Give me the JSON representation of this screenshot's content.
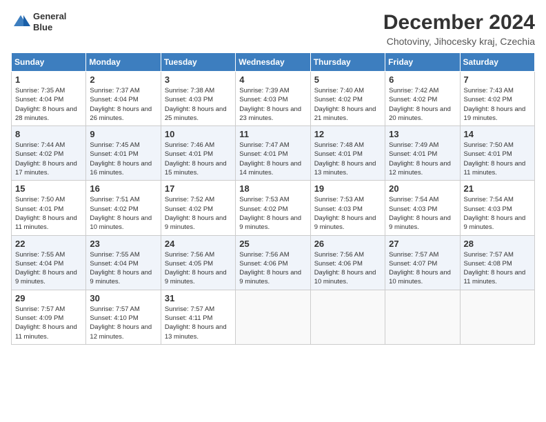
{
  "header": {
    "logo_line1": "General",
    "logo_line2": "Blue",
    "month_title": "December 2024",
    "location": "Chotoviny, Jihocesky kraj, Czechia"
  },
  "weekdays": [
    "Sunday",
    "Monday",
    "Tuesday",
    "Wednesday",
    "Thursday",
    "Friday",
    "Saturday"
  ],
  "weeks": [
    [
      {
        "day": "1",
        "sunrise": "7:35 AM",
        "sunset": "4:04 PM",
        "daylight": "8 hours and 28 minutes."
      },
      {
        "day": "2",
        "sunrise": "7:37 AM",
        "sunset": "4:04 PM",
        "daylight": "8 hours and 26 minutes."
      },
      {
        "day": "3",
        "sunrise": "7:38 AM",
        "sunset": "4:03 PM",
        "daylight": "8 hours and 25 minutes."
      },
      {
        "day": "4",
        "sunrise": "7:39 AM",
        "sunset": "4:03 PM",
        "daylight": "8 hours and 23 minutes."
      },
      {
        "day": "5",
        "sunrise": "7:40 AM",
        "sunset": "4:02 PM",
        "daylight": "8 hours and 21 minutes."
      },
      {
        "day": "6",
        "sunrise": "7:42 AM",
        "sunset": "4:02 PM",
        "daylight": "8 hours and 20 minutes."
      },
      {
        "day": "7",
        "sunrise": "7:43 AM",
        "sunset": "4:02 PM",
        "daylight": "8 hours and 19 minutes."
      }
    ],
    [
      {
        "day": "8",
        "sunrise": "7:44 AM",
        "sunset": "4:02 PM",
        "daylight": "8 hours and 17 minutes."
      },
      {
        "day": "9",
        "sunrise": "7:45 AM",
        "sunset": "4:01 PM",
        "daylight": "8 hours and 16 minutes."
      },
      {
        "day": "10",
        "sunrise": "7:46 AM",
        "sunset": "4:01 PM",
        "daylight": "8 hours and 15 minutes."
      },
      {
        "day": "11",
        "sunrise": "7:47 AM",
        "sunset": "4:01 PM",
        "daylight": "8 hours and 14 minutes."
      },
      {
        "day": "12",
        "sunrise": "7:48 AM",
        "sunset": "4:01 PM",
        "daylight": "8 hours and 13 minutes."
      },
      {
        "day": "13",
        "sunrise": "7:49 AM",
        "sunset": "4:01 PM",
        "daylight": "8 hours and 12 minutes."
      },
      {
        "day": "14",
        "sunrise": "7:50 AM",
        "sunset": "4:01 PM",
        "daylight": "8 hours and 11 minutes."
      }
    ],
    [
      {
        "day": "15",
        "sunrise": "7:50 AM",
        "sunset": "4:01 PM",
        "daylight": "8 hours and 11 minutes."
      },
      {
        "day": "16",
        "sunrise": "7:51 AM",
        "sunset": "4:02 PM",
        "daylight": "8 hours and 10 minutes."
      },
      {
        "day": "17",
        "sunrise": "7:52 AM",
        "sunset": "4:02 PM",
        "daylight": "8 hours and 9 minutes."
      },
      {
        "day": "18",
        "sunrise": "7:53 AM",
        "sunset": "4:02 PM",
        "daylight": "8 hours and 9 minutes."
      },
      {
        "day": "19",
        "sunrise": "7:53 AM",
        "sunset": "4:03 PM",
        "daylight": "8 hours and 9 minutes."
      },
      {
        "day": "20",
        "sunrise": "7:54 AM",
        "sunset": "4:03 PM",
        "daylight": "8 hours and 9 minutes."
      },
      {
        "day": "21",
        "sunrise": "7:54 AM",
        "sunset": "4:03 PM",
        "daylight": "8 hours and 9 minutes."
      }
    ],
    [
      {
        "day": "22",
        "sunrise": "7:55 AM",
        "sunset": "4:04 PM",
        "daylight": "8 hours and 9 minutes."
      },
      {
        "day": "23",
        "sunrise": "7:55 AM",
        "sunset": "4:04 PM",
        "daylight": "8 hours and 9 minutes."
      },
      {
        "day": "24",
        "sunrise": "7:56 AM",
        "sunset": "4:05 PM",
        "daylight": "8 hours and 9 minutes."
      },
      {
        "day": "25",
        "sunrise": "7:56 AM",
        "sunset": "4:06 PM",
        "daylight": "8 hours and 9 minutes."
      },
      {
        "day": "26",
        "sunrise": "7:56 AM",
        "sunset": "4:06 PM",
        "daylight": "8 hours and 10 minutes."
      },
      {
        "day": "27",
        "sunrise": "7:57 AM",
        "sunset": "4:07 PM",
        "daylight": "8 hours and 10 minutes."
      },
      {
        "day": "28",
        "sunrise": "7:57 AM",
        "sunset": "4:08 PM",
        "daylight": "8 hours and 11 minutes."
      }
    ],
    [
      {
        "day": "29",
        "sunrise": "7:57 AM",
        "sunset": "4:09 PM",
        "daylight": "8 hours and 11 minutes."
      },
      {
        "day": "30",
        "sunrise": "7:57 AM",
        "sunset": "4:10 PM",
        "daylight": "8 hours and 12 minutes."
      },
      {
        "day": "31",
        "sunrise": "7:57 AM",
        "sunset": "4:11 PM",
        "daylight": "8 hours and 13 minutes."
      },
      null,
      null,
      null,
      null
    ]
  ]
}
